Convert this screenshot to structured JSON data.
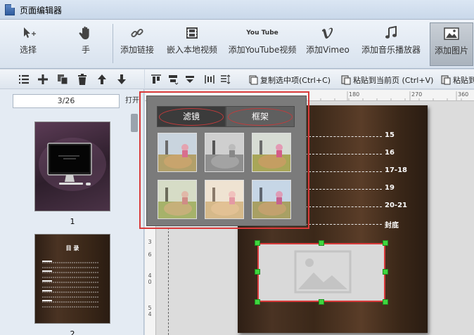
{
  "window": {
    "title": "页面编辑器"
  },
  "ribbon": {
    "buttons": [
      {
        "label": "选择",
        "icon": "select-arrow-icon"
      },
      {
        "label": "手",
        "icon": "hand-icon"
      },
      {
        "label": "添加链接",
        "icon": "link-icon"
      },
      {
        "label": "嵌入本地视频",
        "icon": "film-icon"
      },
      {
        "label": "添加YouTube视频",
        "icon": "youtube-icon"
      },
      {
        "label": "添加Vimeo",
        "icon": "vimeo-icon"
      },
      {
        "label": "添加音乐播放器",
        "icon": "music-note-icon"
      },
      {
        "label": "添加图片",
        "icon": "image-icon",
        "active": true
      }
    ],
    "youtube_badge": "You Tube"
  },
  "left_panel": {
    "page_indicator": "3/26",
    "open_button": "打开",
    "thumbnails": [
      {
        "number": "1"
      },
      {
        "number": "2"
      }
    ],
    "thumb2": {
      "title": "目 录"
    }
  },
  "toolbar2": {
    "copy": "复制选中项(Ctrl+C)",
    "paste_current": "粘贴到当前页 (Ctrl+V)",
    "paste_to": "粘贴到"
  },
  "ruler": {
    "h": [
      "180",
      "270",
      "360"
    ],
    "v": [
      "3",
      "6",
      "4",
      "0",
      "5",
      "4"
    ]
  },
  "page": {
    "toc": [
      "15",
      "16",
      "17-18",
      "19",
      "20-21"
    ],
    "cover": "封底"
  },
  "filter_panel": {
    "tabs": [
      {
        "label": "滤镜",
        "active": true
      },
      {
        "label": "框架",
        "active": false
      }
    ],
    "presets": [
      "normal",
      "grayscale",
      "warm",
      "vintage",
      "faded",
      "cool"
    ]
  },
  "colors": {
    "highlight": "#d93a3a",
    "handle": "#3fd63f"
  }
}
